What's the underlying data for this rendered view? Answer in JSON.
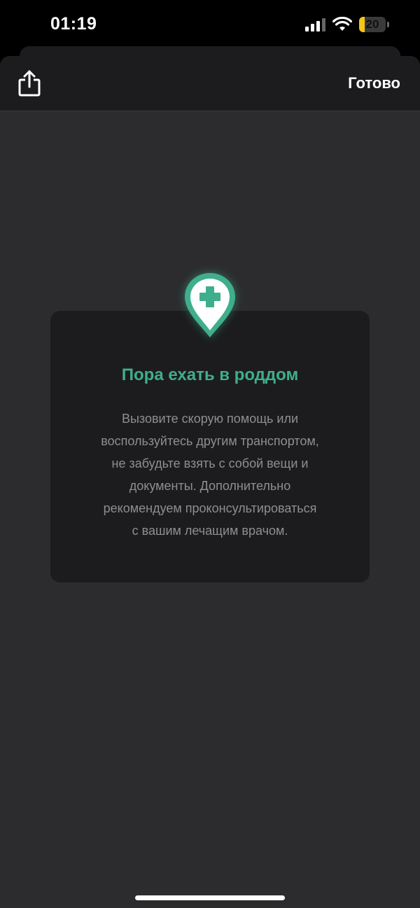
{
  "status_bar": {
    "time": "01:19",
    "battery_percent": 20,
    "battery_label": "20",
    "signal_bars": 3,
    "icons": [
      "cellular-signal-icon",
      "wifi-icon",
      "battery-icon"
    ]
  },
  "header": {
    "share_icon": "share-icon",
    "done_label": "Готово"
  },
  "card": {
    "icon": "map-pin-medical-cross-icon",
    "title": "Пора ехать в роддом",
    "text": "Вызовите скорую помощь или\nвоспользуйтесь другим транспортом,\nне забудьте взять с собой вещи и\nдокументы. Дополнительно\nрекомендуем проконсультироваться\nс вашим лечащим врачом."
  },
  "colors": {
    "accent": "#3fae8c",
    "sheet_background": "#2c2c2e",
    "card_background": "#1c1c1e",
    "body_text": "#8e8e93",
    "battery": "#f5c518"
  }
}
